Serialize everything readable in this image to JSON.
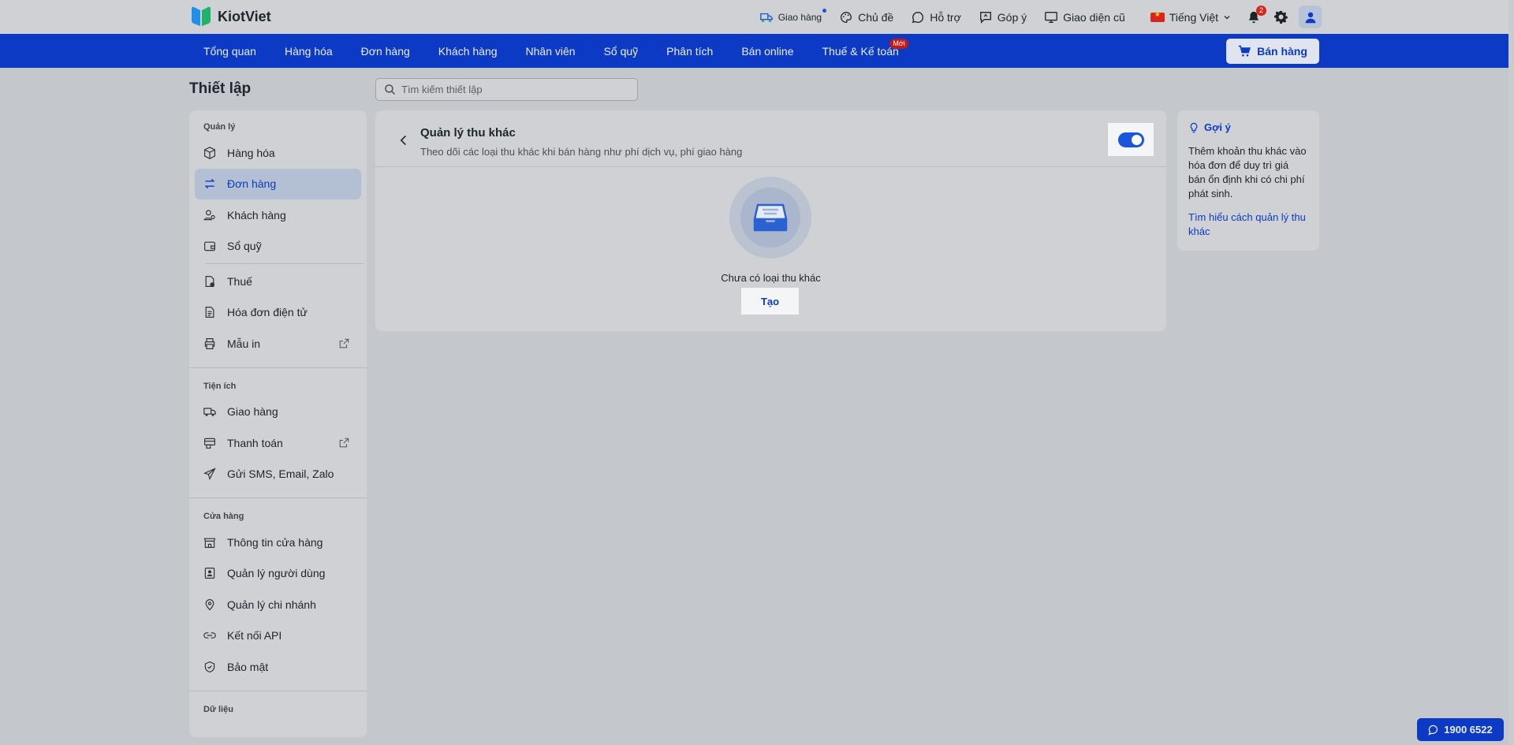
{
  "brand": {
    "name": "KiotViet"
  },
  "topbar": {
    "delivery": "Giao hàng",
    "theme": "Chủ đề",
    "support": "Hỗ trợ",
    "feedback": "Góp ý",
    "old_ui": "Giao diện cũ",
    "language": "Tiếng Việt",
    "notification_count": "2"
  },
  "nav": {
    "items": [
      "Tổng quan",
      "Hàng hóa",
      "Đơn hàng",
      "Khách hàng",
      "Nhân viên",
      "Sổ quỹ",
      "Phân tích",
      "Bán online",
      "Thuế & Kế toán"
    ],
    "new_badge": "Mới",
    "sell_button": "Bán hàng"
  },
  "page": {
    "title": "Thiết lập",
    "search_placeholder": "Tìm kiếm thiết lập"
  },
  "sidebar": {
    "sections": [
      {
        "title": "Quản lý",
        "items": [
          "Hàng hóa",
          "Đơn hàng",
          "Khách hàng",
          "Sổ quỹ",
          "Thuế",
          "Hóa đơn điện tử",
          "Mẫu in"
        ]
      },
      {
        "title": "Tiện ích",
        "items": [
          "Giao hàng",
          "Thanh toán",
          "Gửi SMS, Email, Zalo"
        ]
      },
      {
        "title": "Cửa hàng",
        "items": [
          "Thông tin cửa hàng",
          "Quản lý người dùng",
          "Quản lý chi nhánh",
          "Kết nối API",
          "Bảo mật"
        ]
      },
      {
        "title": "Dữ liệu",
        "items": []
      }
    ],
    "active_item": "Đơn hàng"
  },
  "card": {
    "title": "Quản lý thu khác",
    "subtitle": "Theo dõi các loại thu khác khi bán hàng như phí dịch vụ, phí giao hàng",
    "toggle_on": true,
    "empty_text": "Chưa có loại thu khác",
    "create_button": "Tạo"
  },
  "hint": {
    "title": "Gợi ý",
    "body": "Thêm khoản thu khác vào hóa đơn để duy trì giá bán ổn định khi có chi phí phát sinh.",
    "link": "Tìm hiểu cách quản lý thu khác"
  },
  "hotline": "1900 6522",
  "colors": {
    "primary": "#0c3ac4",
    "badge": "#d7261e"
  }
}
